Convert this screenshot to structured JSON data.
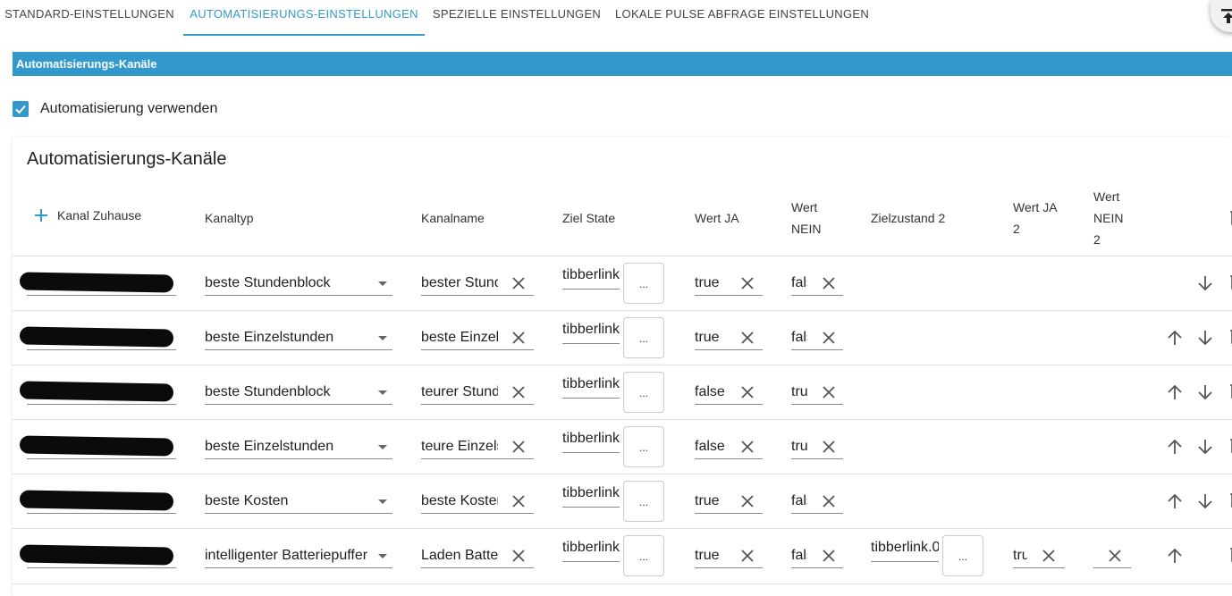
{
  "tabs": [
    {
      "label": "STANDARD-EINSTELLUNGEN",
      "active": false
    },
    {
      "label": "AUTOMATISIERUNGS-EINSTELLUNGEN",
      "active": true
    },
    {
      "label": "SPEZIELLE EINSTELLUNGEN",
      "active": false
    },
    {
      "label": "LOKALE PULSE ABFRAGE EINSTELLUNGEN",
      "active": false
    }
  ],
  "banner": {
    "title": "Automatisierungs-Kanäle"
  },
  "checkbox": {
    "label": "Automatisierung verwenden",
    "checked": true
  },
  "panel": {
    "title": "Automatisierungs-Kanäle"
  },
  "table": {
    "headers": {
      "kanal": "Kanal Zuhause",
      "kanaltyp": "Kanaltyp",
      "kanalname": "Kanalname",
      "ziel_state": "Ziel State",
      "wert_ja": "Wert JA",
      "wert_nein_1": "Wert",
      "wert_nein_2": "NEIN",
      "zielzustand2": "Zielzustand 2",
      "wert_ja2_1": "Wert JA",
      "wert_ja2_2": "2",
      "wert_nein2_1": "Wert",
      "wert_nein2_2": "NEIN",
      "wert_nein2_3": "2"
    },
    "rows": [
      {
        "kanaltyp": "beste Stundenblock",
        "kanalname": "bester Stundenblock",
        "ziel": "tibberlink",
        "ja": "true",
        "nein": "false",
        "ziel2": "",
        "ja2": "",
        "nein2": "",
        "up": false,
        "down": true
      },
      {
        "kanaltyp": "beste Einzelstunden",
        "kanalname": "beste Einzelstunden",
        "ziel": "tibberlink",
        "ja": "true",
        "nein": "false",
        "ziel2": "",
        "ja2": "",
        "nein2": "",
        "up": true,
        "down": true
      },
      {
        "kanaltyp": "beste Stundenblock",
        "kanalname": "teurer Stundenblock",
        "ziel": "tibberlink",
        "ja": "false",
        "nein": "true",
        "ziel2": "",
        "ja2": "",
        "nein2": "",
        "up": true,
        "down": true
      },
      {
        "kanaltyp": "beste Einzelstunden",
        "kanalname": "teure Einzelstunden",
        "ziel": "tibberlink",
        "ja": "false",
        "nein": "true",
        "ziel2": "",
        "ja2": "",
        "nein2": "",
        "up": true,
        "down": true
      },
      {
        "kanaltyp": "beste Kosten",
        "kanalname": "beste Kosten",
        "ziel": "tibberlink",
        "ja": "true",
        "nein": "false",
        "ziel2": "",
        "ja2": "",
        "nein2": "",
        "up": true,
        "down": true
      },
      {
        "kanaltyp": "intelligenter Batteriepuffer",
        "kanalname": "Laden Batterie",
        "ziel": "tibberlink",
        "ja": "true",
        "nein": "false",
        "ziel2": "tibberlink.0",
        "ja2": "true",
        "nein2": "",
        "up": true,
        "down": false
      }
    ],
    "dots_label": "..."
  },
  "colors": {
    "accent": "#3399cc",
    "text": "#202124"
  }
}
